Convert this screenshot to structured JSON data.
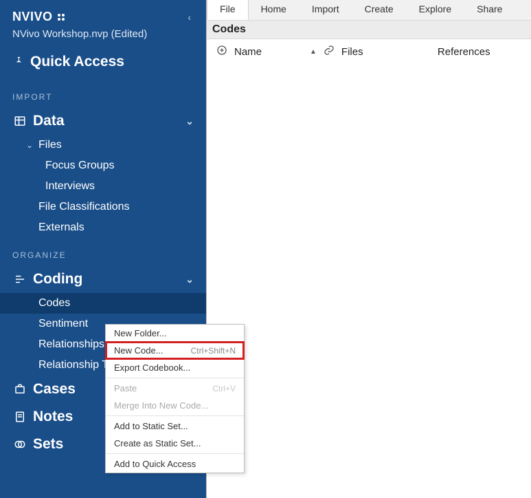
{
  "app": {
    "logo_text": "NVIVO",
    "collapse_caret": "‹",
    "project_name": "NVivo Workshop.nvp (Edited)"
  },
  "quick_access": {
    "label": "Quick Access"
  },
  "sections": {
    "import_label": "IMPORT",
    "organize_label": "ORGANIZE"
  },
  "tree": {
    "data": {
      "label": "Data",
      "files_label": "Files",
      "focus_groups_label": "Focus Groups",
      "interviews_label": "Interviews",
      "file_classifications_label": "File Classifications",
      "externals_label": "Externals"
    },
    "coding": {
      "label": "Coding",
      "codes_label": "Codes",
      "sentiment_label": "Sentiment",
      "relationships_label": "Relationships",
      "relationship_types_label": "Relationship Types"
    },
    "cases": {
      "label": "Cases"
    },
    "notes": {
      "label": "Notes"
    },
    "sets": {
      "label": "Sets"
    }
  },
  "ribbon": {
    "tabs": [
      {
        "label": "File"
      },
      {
        "label": "Home"
      },
      {
        "label": "Import"
      },
      {
        "label": "Create"
      },
      {
        "label": "Explore"
      },
      {
        "label": "Share"
      }
    ]
  },
  "main": {
    "panel_title": "Codes",
    "columns": {
      "name": "Name",
      "files": "Files",
      "references": "References"
    }
  },
  "context_menu": {
    "new_folder": {
      "label": "New Folder..."
    },
    "new_code": {
      "label": "New Code...",
      "accel": "Ctrl+Shift+N"
    },
    "export_codebook": {
      "label": "Export Codebook..."
    },
    "paste": {
      "label": "Paste",
      "accel": "Ctrl+V"
    },
    "merge_into": {
      "label": "Merge Into New Code..."
    },
    "add_to_static": {
      "label": "Add to Static Set..."
    },
    "create_as_static": {
      "label": "Create as Static Set..."
    },
    "add_to_quick": {
      "label": "Add to Quick Access"
    }
  }
}
